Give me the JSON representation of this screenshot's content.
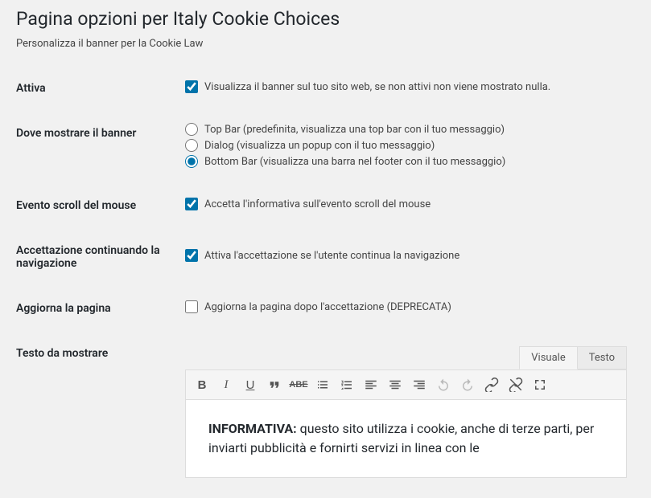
{
  "page": {
    "title": "Pagina opzioni per Italy Cookie Choices",
    "subtitle": "Personalizza il banner per la Cookie Law"
  },
  "fields": {
    "active": {
      "label": "Attiva",
      "text": "Visualizza il banner sul tuo sito web, se non attivi non viene mostrato nulla.",
      "checked": true
    },
    "position": {
      "label": "Dove mostrare il banner",
      "options": [
        "Top Bar (predefinita, visualizza una top bar con il tuo messaggio)",
        "Dialog (visualizza un popup con il tuo messaggio)",
        "Bottom Bar (visualizza una barra nel footer con il tuo messaggio)"
      ],
      "selected": 2
    },
    "scroll": {
      "label": "Evento scroll del mouse",
      "text": "Accetta l'informativa sull'evento scroll del mouse",
      "checked": true
    },
    "continue_nav": {
      "label": "Accettazione continuando la navigazione",
      "text": "Attiva l'accettazione se l'utente continua la navigazione",
      "checked": true
    },
    "reload": {
      "label": "Aggiorna la pagina",
      "text": "Aggiorna la pagina dopo l'accettazione (DEPRECATA)",
      "checked": false
    },
    "text": {
      "label": "Testo da mostrare",
      "tabs": {
        "visual": "Visuale",
        "text": "Testo"
      },
      "content_bold": "INFORMATIVA:",
      "content_rest": " questo sito utilizza i cookie, anche di terze parti, per inviarti pubblicità e fornirti servizi in linea con le"
    }
  }
}
